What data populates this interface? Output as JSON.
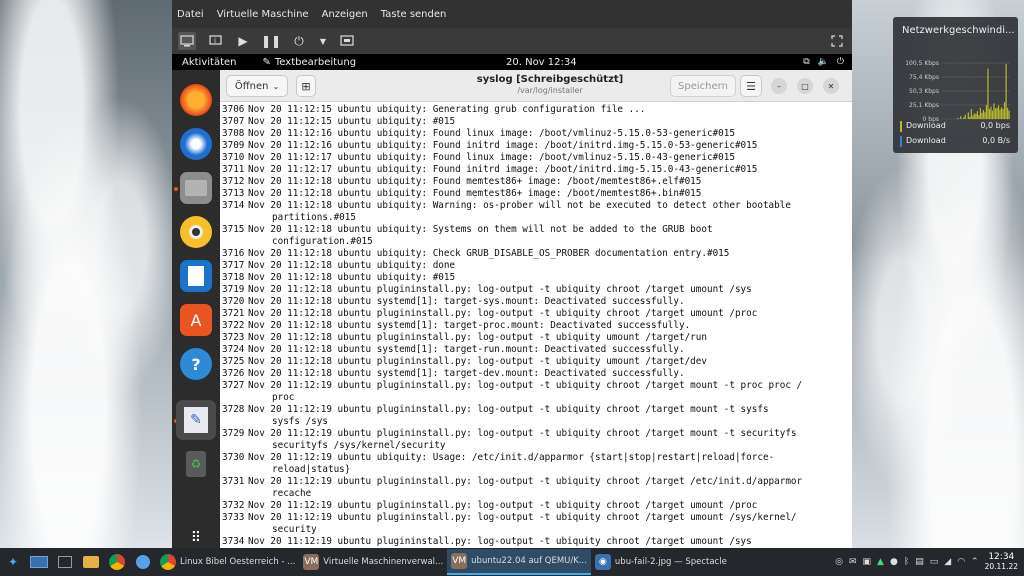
{
  "host_menu": [
    "Datei",
    "Virtuelle Maschine",
    "Anzeigen",
    "Taste senden"
  ],
  "guest_topbar": {
    "activities": "Aktivitäten",
    "app_name": "Textbearbeitung",
    "clock": "20. Nov  12:34"
  },
  "editor": {
    "open_label": "Öffnen",
    "title": "syslog [Schreibgeschützt]",
    "subtitle": "/var/log/installer",
    "save_label": "Speichern"
  },
  "log_lines": [
    {
      "n": "3706",
      "t": "Nov 20 11:12:15 ubuntu ubiquity: Generating grub configuration file ..."
    },
    {
      "n": "3707",
      "t": "Nov 20 11:12:15 ubuntu ubiquity: #015"
    },
    {
      "n": "3708",
      "t": "Nov 20 11:12:16 ubuntu ubiquity: Found linux image: /boot/vmlinuz-5.15.0-53-generic#015"
    },
    {
      "n": "3709",
      "t": "Nov 20 11:12:16 ubuntu ubiquity: Found initrd image: /boot/initrd.img-5.15.0-53-generic#015"
    },
    {
      "n": "3710",
      "t": "Nov 20 11:12:17 ubuntu ubiquity: Found linux image: /boot/vmlinuz-5.15.0-43-generic#015"
    },
    {
      "n": "3711",
      "t": "Nov 20 11:12:17 ubuntu ubiquity: Found initrd image: /boot/initrd.img-5.15.0-43-generic#015"
    },
    {
      "n": "3712",
      "t": "Nov 20 11:12:18 ubuntu ubiquity: Found memtest86+ image: /boot/memtest86+.elf#015"
    },
    {
      "n": "3713",
      "t": "Nov 20 11:12:18 ubuntu ubiquity: Found memtest86+ image: /boot/memtest86+.bin#015"
    },
    {
      "n": "3714",
      "t": "Nov 20 11:12:18 ubuntu ubiquity: Warning: os-prober will not be executed to detect other bootable"
    },
    {
      "n": "",
      "t": "partitions.#015"
    },
    {
      "n": "3715",
      "t": "Nov 20 11:12:18 ubuntu ubiquity: Systems on them will not be added to the GRUB boot"
    },
    {
      "n": "",
      "t": "configuration.#015"
    },
    {
      "n": "3716",
      "t": "Nov 20 11:12:18 ubuntu ubiquity: Check GRUB_DISABLE_OS_PROBER documentation entry.#015"
    },
    {
      "n": "3717",
      "t": "Nov 20 11:12:18 ubuntu ubiquity: done"
    },
    {
      "n": "3718",
      "t": "Nov 20 11:12:18 ubuntu ubiquity: #015"
    },
    {
      "n": "3719",
      "t": "Nov 20 11:12:18 ubuntu plugininstall.py: log-output -t ubiquity chroot /target umount /sys"
    },
    {
      "n": "3720",
      "t": "Nov 20 11:12:18 ubuntu systemd[1]: target-sys.mount: Deactivated successfully."
    },
    {
      "n": "3721",
      "t": "Nov 20 11:12:18 ubuntu plugininstall.py: log-output -t ubiquity chroot /target umount /proc"
    },
    {
      "n": "3722",
      "t": "Nov 20 11:12:18 ubuntu systemd[1]: target-proc.mount: Deactivated successfully."
    },
    {
      "n": "3723",
      "t": "Nov 20 11:12:18 ubuntu plugininstall.py: log-output -t ubiquity umount /target/run"
    },
    {
      "n": "3724",
      "t": "Nov 20 11:12:18 ubuntu systemd[1]: target-run.mount: Deactivated successfully."
    },
    {
      "n": "3725",
      "t": "Nov 20 11:12:18 ubuntu plugininstall.py: log-output -t ubiquity umount /target/dev"
    },
    {
      "n": "3726",
      "t": "Nov 20 11:12:18 ubuntu systemd[1]: target-dev.mount: Deactivated successfully."
    },
    {
      "n": "3727",
      "t": "Nov 20 11:12:19 ubuntu plugininstall.py: log-output -t ubiquity chroot /target mount -t proc proc /"
    },
    {
      "n": "",
      "t": "proc"
    },
    {
      "n": "3728",
      "t": "Nov 20 11:12:19 ubuntu plugininstall.py: log-output -t ubiquity chroot /target mount -t sysfs"
    },
    {
      "n": "",
      "t": "sysfs /sys"
    },
    {
      "n": "3729",
      "t": "Nov 20 11:12:19 ubuntu plugininstall.py: log-output -t ubiquity chroot /target mount -t securityfs"
    },
    {
      "n": "",
      "t": "securityfs /sys/kernel/security"
    },
    {
      "n": "3730",
      "t": "Nov 20 11:12:19 ubuntu ubiquity: Usage: /etc/init.d/apparmor {start|stop|restart|reload|force-"
    },
    {
      "n": "",
      "t": "reload|status}"
    },
    {
      "n": "3731",
      "t": "Nov 20 11:12:19 ubuntu plugininstall.py: log-output -t ubiquity chroot /target /etc/init.d/apparmor"
    },
    {
      "n": "",
      "t": "recache"
    },
    {
      "n": "3732",
      "t": "Nov 20 11:12:19 ubuntu plugininstall.py: log-output -t ubiquity chroot /target umount /proc"
    },
    {
      "n": "3733",
      "t": "Nov 20 11:12:19 ubuntu plugininstall.py: log-output -t ubiquity chroot /target umount /sys/kernel/"
    },
    {
      "n": "",
      "t": "security"
    },
    {
      "n": "3734",
      "t": "Nov 20 11:12:19 ubuntu plugininstall.py: log-output -t ubiquity chroot /target umount /sys"
    }
  ],
  "network_widget": {
    "title": "Netzwerkgeschwindi...",
    "y_ticks": [
      "100,5 Kbps",
      "75,4 Kbps",
      "50,3 Kbps",
      "25,1 Kbps",
      "0 bps"
    ],
    "rows": [
      {
        "label": "Download",
        "value": "0,0 bps",
        "color": "#b8b82e"
      },
      {
        "label": "Download",
        "value": "0,0 B/s",
        "color": "#3a7fd5"
      }
    ],
    "activity": [
      0,
      0,
      0,
      0,
      0,
      0,
      0,
      0,
      0,
      0,
      0.02,
      0,
      0.05,
      0,
      0.03,
      0.08,
      0,
      0.12,
      0.04,
      0.18,
      0.06,
      0.1,
      0.09,
      0.14,
      0.07,
      0.2,
      0.11,
      0.16,
      0.12,
      0.25,
      0.9,
      0.18,
      0.22,
      0.15,
      0.28,
      0.19,
      0.2,
      0.24,
      0.17,
      0.21,
      0.18,
      0.3,
      0.98,
      0.2,
      0.15
    ]
  },
  "taskbar": {
    "tasks": [
      {
        "label": "Linux Bibel Oesterreich - ...",
        "icon_color": "#db4437"
      },
      {
        "label": "Virtuelle Maschinenverwal...",
        "icon_color": "#8a6d5a"
      },
      {
        "label": "ubuntu22.04 auf QEMU/K...",
        "icon_color": "#8a6d5a"
      },
      {
        "label": "ubu-fail-2.jpg — Spectacle",
        "icon_color": "#3a6fb0"
      }
    ],
    "clock_time": "12:34",
    "clock_date": "20.11.22"
  },
  "colors": {
    "accent": "#e95420",
    "taskbar_active": "#3daee9"
  }
}
